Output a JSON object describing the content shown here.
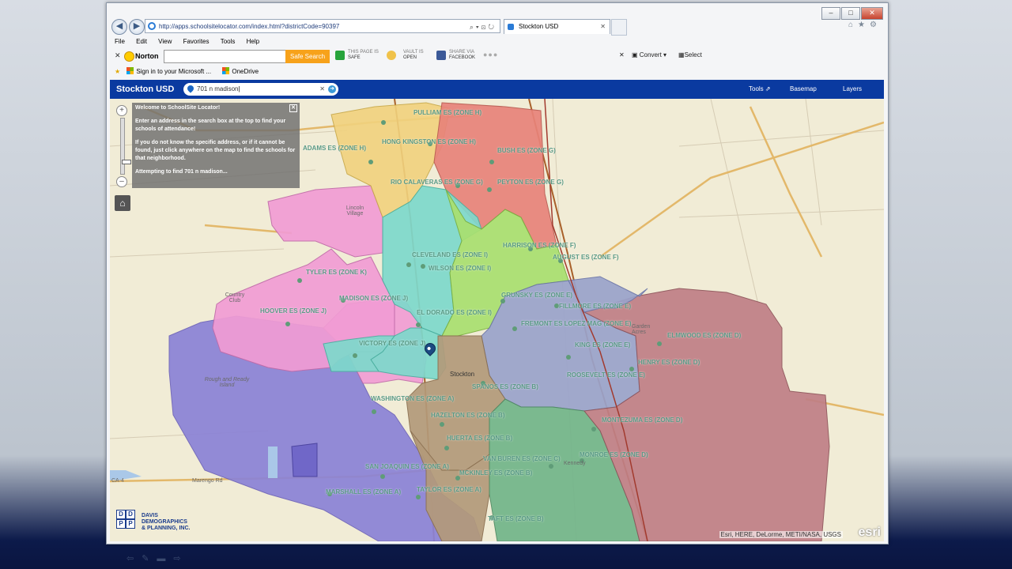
{
  "browser": {
    "address": "http://apps.schoolsitelocator.com/index.html?districtCode=90397",
    "tab_title": "Stockton USD",
    "menu": [
      "File",
      "Edit",
      "View",
      "Favorites",
      "Tools",
      "Help"
    ],
    "norton": {
      "brand": "Norton",
      "safe_search": "Safe Search",
      "page_status_top": "THIS PAGE IS",
      "page_status": "SAFE",
      "vault_top": "VAULT IS",
      "vault": "OPEN",
      "share_top": "SHARE VIA",
      "share": "FACEBOOK",
      "convert": "Convert",
      "select": "Select"
    },
    "favorites": [
      "Sign in to your Microsoft ...",
      "OneDrive"
    ]
  },
  "app": {
    "title": "Stockton USD",
    "search_value": "701 n madison",
    "tools": "Tools",
    "basemap": "Basemap",
    "layers": "Layers"
  },
  "welcome": {
    "title": "Welcome to SchoolSite Locator!",
    "p1": "Enter an address in the search box at the top to find your schools of attendance!",
    "p2": "If you do not know the specific address, or if it cannot be found, just click anywhere on the map to find the schools for that neighborhood.",
    "status": "Attempting to find 701 n madison..."
  },
  "schools": [
    {
      "name": "PULLIAM ES (ZONE H)"
    },
    {
      "name": "ADAMS ES (ZONE H)"
    },
    {
      "name": "HONG KINGSTON ES (ZONE H)"
    },
    {
      "name": "BUSH ES (ZONE G)"
    },
    {
      "name": "RIO CALAVERAS ES (ZONE G)"
    },
    {
      "name": "PEYTON ES (ZONE G)"
    },
    {
      "name": "HARRISON ES (ZONE F)"
    },
    {
      "name": "AUGUST ES (ZONE F)"
    },
    {
      "name": "CLEVELAND ES (ZONE I)"
    },
    {
      "name": "WILSON ES (ZONE I)"
    },
    {
      "name": "TYLER ES (ZONE K)"
    },
    {
      "name": "MADISON ES (ZONE J)"
    },
    {
      "name": "GRUNSKY ES (ZONE E)"
    },
    {
      "name": "FILLMORE ES (ZONE E)"
    },
    {
      "name": "HOOVER ES (ZONE J)"
    },
    {
      "name": "EL DORADO ES (ZONE I)"
    },
    {
      "name": "FREMONT ES LOPEZ MAG (ZONE E)"
    },
    {
      "name": "ELMWOOD ES (ZONE D)"
    },
    {
      "name": "VICTORY ES (ZONE J)"
    },
    {
      "name": "KING ES (ZONE E)"
    },
    {
      "name": "HENRY ES (ZONE D)"
    },
    {
      "name": "ROOSEVELT ES (ZONE E)"
    },
    {
      "name": "SPANOS ES (ZONE B)"
    },
    {
      "name": "WASHINGTON ES (ZONE A)"
    },
    {
      "name": "HAZELTON ES (ZONE B)"
    },
    {
      "name": "MONTEZUMA ES (ZONE D)"
    },
    {
      "name": "HUERTA ES (ZONE B)"
    },
    {
      "name": "VAN BUREN ES (ZONE C)"
    },
    {
      "name": "MONROE ES (ZONE D)"
    },
    {
      "name": "SAN JOAQUIN ES (ZONE A)"
    },
    {
      "name": "MCKINLEY ES (ZONE B)"
    },
    {
      "name": "MARSHALL ES (ZONE A)"
    },
    {
      "name": "TAYLOR ES (ZONE A)"
    },
    {
      "name": "TAFT ES (ZONE B)"
    }
  ],
  "place_labels": {
    "stockton": "Stockton",
    "rough_ready": "Rough and Ready Island",
    "kennedy": "Kennedy",
    "garden_acres": "Garden Acres",
    "marengo": "Marengo Rd",
    "ca4": "CA-4",
    "country_club": "Country Club",
    "lincoln_village": "Lincoln Village"
  },
  "logo": {
    "line1": "DAVIS",
    "line2": "DEMOGRAPHICS",
    "line3": "& PLANNING, INC."
  },
  "attribution": "Esri, HERE, DeLorme, METI/NASA, USGS",
  "esri": "esri",
  "zones": {
    "A": "#8b82d6",
    "B": "#b39a7a",
    "C": "#72b58a",
    "D": "#c07f86",
    "E": "#9aa3cb",
    "F": "#a9e06f",
    "G": "#e8837a",
    "H": "#f1d27e",
    "I": "#7ed9cc",
    "J": "#f19cd4",
    "K": "#f19cd4"
  }
}
